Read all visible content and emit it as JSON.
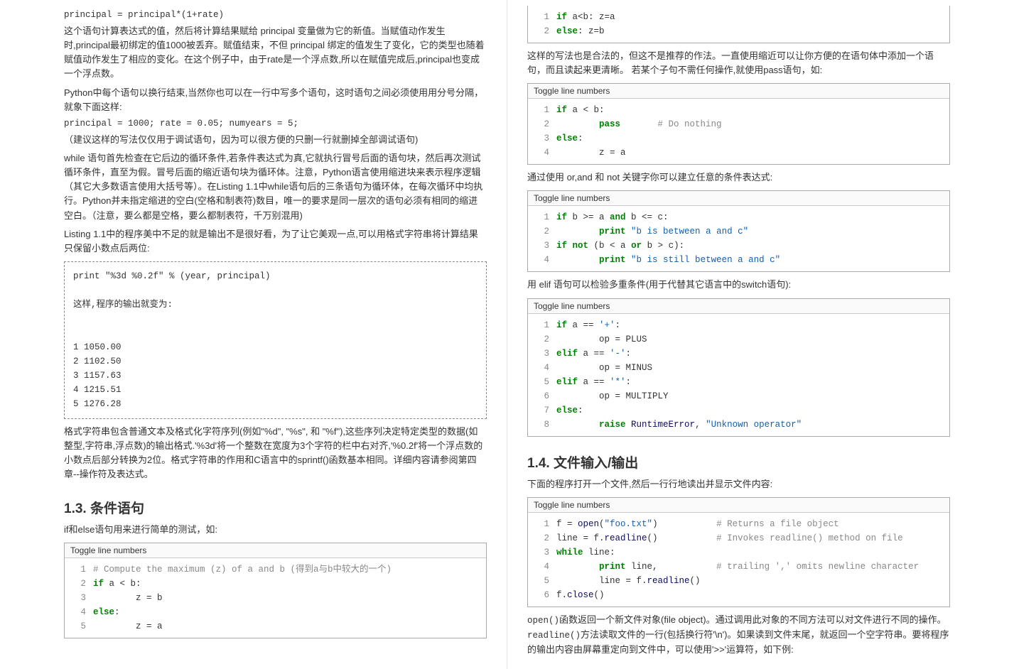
{
  "left": {
    "code1": "principal = principal*(1+rate)",
    "para1": "这个语句计算表达式的值，然后将计算结果赋给 principal 变量做为它的新值。当赋值动作发生时,principal最初绑定的值1000被丢弃。赋值结束，不但 principal 绑定的值发生了变化，它的类型也随着赋值动作发生了相应的变化。在这个例子中，由于rate是一个浮点数,所以在赋值完成后,principal也变成一个浮点数。",
    "para2": "Python中每个语句以换行结束,当然你也可以在一行中写多个语句，这时语句之间必须使用用分号分隔，就象下面这样:",
    "code2": "principal = 1000; rate = 0.05; numyears = 5;",
    "para3": "（建议这样的写法仅仅用于调试语句，因为可以很方便的只删一行就删掉全部调试语句)",
    "para4": "while 语句首先检查在它后边的循环条件,若条件表达式为真,它就执行冒号后面的语句块，然后再次测试循环条件，直至为假。冒号后面的缩近语句块为循环体。注意，Python语言使用缩进块来表示程序逻辑（其它大多数语言使用大括号等）。在Listing 1.1中while语句后的三条语句为循环体，在每次循环中均执行。Python并未指定缩进的空白(空格和制表符)数目，唯一的要求是同一层次的语句必须有相同的缩进空白。（注意，要么都是空格，要么都制表符，千万别混用)",
    "para5": "Listing 1.1中的程序美中不足的就是输出不是很好看，为了让它美观一点,可以用格式字符串将计算结果只保留小数点后两位:",
    "dashedbox": "print \"%3d %0.2f\" % (year, principal)\n\n这样,程序的输出就变为:\n\n\n1 1050.00\n2 1102.50\n3 1157.63\n4 1215.51\n5 1276.28",
    "para6": "格式字符串包含普通文本及格式化字符序列(例如\"%d\", \"%s\", 和 \"%f\"),这些序列决定特定类型的数据(如整型,字符串,浮点数)的输出格式.'%3d'将一个整数在宽度为3个字符的栏中右对齐,'%0.2f'将一个浮点数的小数点后部分转换为2位。格式字符串的作用和C语言中的sprintf()函数基本相同。详细内容请参阅第四章--操作符及表达式。",
    "h13": "1.3.  条件语句",
    "para7": "if和else语句用来进行简单的测试，如:",
    "toggle": "Toggle line numbers",
    "codeA": [
      {
        "n": "1",
        "h": "<span class='cmt'># Compute the maximum (z) of a and b (得到a与b中较大的一个)</span>"
      },
      {
        "n": "2",
        "h": "<span class='kw'>if</span> a &lt; b:"
      },
      {
        "n": "3",
        "h": "        z = b"
      },
      {
        "n": "4",
        "h": "<span class='kw'>else</span>:"
      },
      {
        "n": "5",
        "h": "        z = a"
      }
    ]
  },
  "right": {
    "tinycode": [
      {
        "n": "1",
        "h": "<span class='kw'>if</span> a&lt;b: z=a"
      },
      {
        "n": "2",
        "h": "<span class='kw'>else</span>: z=b"
      }
    ],
    "para1": "这样的写法也是合法的，但这不是推荐的作法。一直使用缩近可以让你方便的在语句体中添加一个语句，而且读起来更清晰。 若某个子句不需任何操作,就使用pass语句，如:",
    "toggle": "Toggle line numbers",
    "codeB": [
      {
        "n": "1",
        "h": "<span class='kw'>if</span> a &lt; b:"
      },
      {
        "n": "2",
        "h": "        <span class='kw'>pass</span>       <span class='cmt'># Do nothing</span>"
      },
      {
        "n": "3",
        "h": "<span class='kw'>else</span>:"
      },
      {
        "n": "4",
        "h": "        z = a"
      }
    ],
    "para2": "通过使用 or,and 和 not 关键字你可以建立任意的条件表达式:",
    "codeC": [
      {
        "n": "1",
        "h": "<span class='kw'>if</span> b &gt;= a <span class='kw'>and</span> b &lt;= c:"
      },
      {
        "n": "2",
        "h": "        <span class='kw'>print</span> <span class='str'>\"b is between a and c\"</span>"
      },
      {
        "n": "3",
        "h": "<span class='kw'>if</span> <span class='kw'>not</span> (b &lt; a <span class='kw'>or</span> b &gt; c):"
      },
      {
        "n": "4",
        "h": "        <span class='kw'>print</span> <span class='str'>\"b is still between a and c\"</span>"
      }
    ],
    "para3": "用 elif 语句可以检验多重条件(用于代替其它语言中的switch语句):",
    "codeD": [
      {
        "n": "1",
        "h": "<span class='kw'>if</span> a == <span class='str'>'+'</span>:"
      },
      {
        "n": "2",
        "h": "        op = PLUS"
      },
      {
        "n": "3",
        "h": "<span class='kw'>elif</span> a == <span class='str'>'-'</span>:"
      },
      {
        "n": "4",
        "h": "        op = MINUS"
      },
      {
        "n": "5",
        "h": "<span class='kw'>elif</span> a == <span class='str'>'*'</span>:"
      },
      {
        "n": "6",
        "h": "        op = MULTIPLY"
      },
      {
        "n": "7",
        "h": "<span class='kw'>else</span>:"
      },
      {
        "n": "8",
        "h": "        <span class='kw'>raise</span> <span class='name'>RuntimeError</span>, <span class='str'>\"Unknown operator\"</span>"
      }
    ],
    "h14": "1.4.  文件输入/输出",
    "para4": "下面的程序打开一个文件,然后一行行地读出并显示文件内容:",
    "codeE": [
      {
        "n": "1",
        "h": "f = <span class='name'>open</span>(<span class='str'>\"foo.txt\"</span>)           <span class='cmt'># Returns a file object</span>"
      },
      {
        "n": "2",
        "h": "line = f.<span class='name'>readline</span>()           <span class='cmt'># Invokes readline() method on file</span>"
      },
      {
        "n": "3",
        "h": "<span class='kw'>while</span> line:"
      },
      {
        "n": "4",
        "h": "        <span class='kw'>print</span> line,           <span class='cmt'># trailing ',' omits newline character</span>"
      },
      {
        "n": "5",
        "h": "        line = f.<span class='name'>readline</span>()"
      },
      {
        "n": "6",
        "h": "f.<span class='name'>close</span>()"
      }
    ],
    "para5_pre": "open()",
    "para5a": "函数返回一个新文件对象(file object)。通过调用此对象的不同方法可以对文件进行不同的操作。",
    "para5b": "readline()",
    "para5c": "方法读取文件的一行(包括换行符'\\n')。如果读到文件末尾，就返回一个空字符串。要将程序的输出内容由屏幕重定向到文件中，可以使用'>>'运算符，如下例:"
  }
}
